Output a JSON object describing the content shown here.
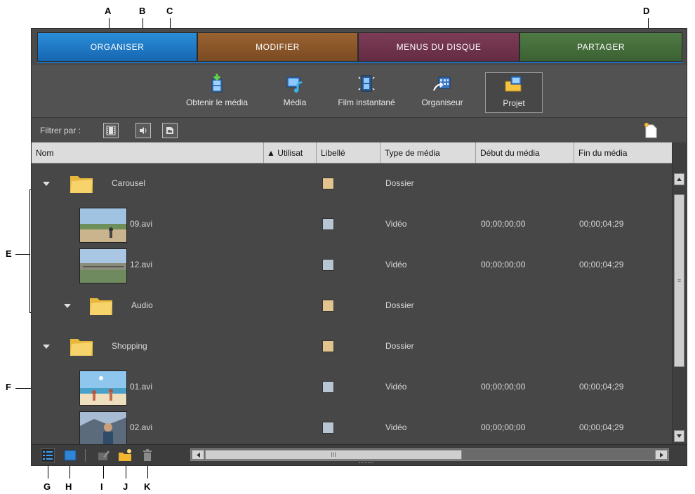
{
  "callouts": {
    "a": "A",
    "b": "B",
    "c": "C",
    "d": "D",
    "e": "E",
    "f": "F",
    "g": "G",
    "h": "H",
    "i": "I",
    "j": "J",
    "k": "K"
  },
  "tabs": [
    {
      "label": "ORGANISER"
    },
    {
      "label": "MODIFIER"
    },
    {
      "label": "MENUS DU DISQUE"
    },
    {
      "label": "PARTAGER"
    }
  ],
  "toolbar": {
    "items": [
      {
        "label": "Obtenir le média",
        "icon": "download-media-icon"
      },
      {
        "label": "Média",
        "icon": "media-icon"
      },
      {
        "label": "Film instantané",
        "icon": "instant-movie-icon"
      },
      {
        "label": "Organiseur",
        "icon": "organizer-icon"
      },
      {
        "label": "Projet",
        "icon": "project-icon",
        "selected": true
      }
    ]
  },
  "filter": {
    "label": "Filtrer par :"
  },
  "columns": {
    "name": "Nom",
    "used": "▲ Utilisat",
    "label": "Libellé",
    "type": "Type de média",
    "start": "Début du média",
    "end": "Fin du média"
  },
  "rows": [
    {
      "name": "Carousel",
      "type": "Dossier",
      "start": "",
      "end": "",
      "kind": "folder",
      "swatch": "#e3c48f"
    },
    {
      "name": "09.avi",
      "type": "Vidéo",
      "start": "00;00;00;00",
      "end": "00;00;04;29",
      "kind": "video",
      "swatch": "#b8c6d3"
    },
    {
      "name": "12.avi",
      "type": "Vidéo",
      "start": "00;00;00;00",
      "end": "00;00;04;29",
      "kind": "video",
      "swatch": "#b8c6d3"
    },
    {
      "name": "Audio",
      "type": "Dossier",
      "start": "",
      "end": "",
      "kind": "folder",
      "swatch": "#e3c48f"
    },
    {
      "name": "Shopping",
      "type": "Dossier",
      "start": "",
      "end": "",
      "kind": "folder",
      "swatch": "#e3c48f"
    },
    {
      "name": "01.avi",
      "type": "Vidéo",
      "start": "00;00;00;00",
      "end": "00;00;04;29",
      "kind": "video",
      "swatch": "#b8c6d3"
    },
    {
      "name": "02.avi",
      "type": "Vidéo",
      "start": "00;00;00;00",
      "end": "00;00;04;29",
      "kind": "video",
      "swatch": "#b8c6d3"
    }
  ],
  "colors": {
    "tab_org": "#1f7acb",
    "tab_mod": "#8a5527",
    "tab_men": "#703349",
    "tab_par": "#46703b",
    "folder": "#f2c94a"
  }
}
